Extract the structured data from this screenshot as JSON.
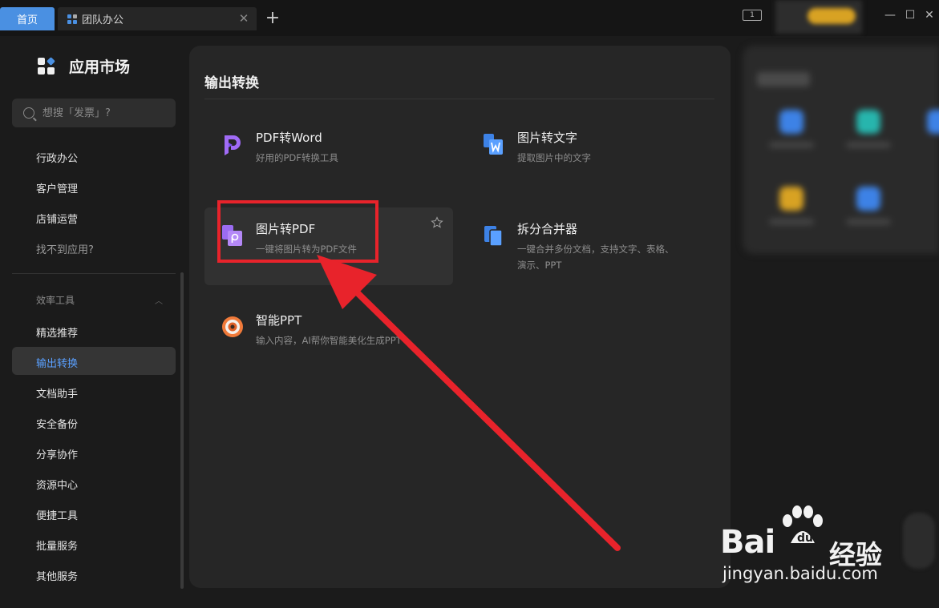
{
  "tabs": {
    "home": "首页",
    "team": "团队办公"
  },
  "window": {
    "layout_label": "1"
  },
  "sidebar": {
    "title": "应用市场",
    "search_placeholder": "想搜「发票」?",
    "items_top": [
      "行政办公",
      "客户管理",
      "店铺运营",
      "找不到应用?"
    ],
    "group_label": "效率工具",
    "items_group": [
      "精选推荐",
      "输出转换",
      "文档助手",
      "安全备份",
      "分享协作",
      "资源中心",
      "便捷工具",
      "批量服务",
      "其他服务"
    ],
    "active_item": "输出转换"
  },
  "main": {
    "section_title": "输出转换",
    "cards": [
      {
        "title": "PDF转Word",
        "desc": "好用的PDF转换工具",
        "icon": "pdf-to-word-icon"
      },
      {
        "title": "图片转文字",
        "desc": "提取图片中的文字",
        "icon": "image-to-text-icon"
      },
      {
        "title": "图片转PDF",
        "desc": "一键将图片转为PDF文件",
        "icon": "image-to-pdf-icon"
      },
      {
        "title": "拆分合并器",
        "desc": "一键合并多份文档，支持文字、表格、演示、PPT",
        "icon": "split-merge-icon"
      },
      {
        "title": "智能PPT",
        "desc": "输入内容，AI帮你智能美化生成PPT",
        "icon": "smart-ppt-icon"
      }
    ]
  },
  "colors": {
    "accent": "#4a90e2",
    "annotation": "#e8232b",
    "pdf_purple": "#8b5cf6"
  },
  "watermark": {
    "brand": "Bai",
    "brand_tail": "经验",
    "url": "jingyan.baidu.com"
  }
}
